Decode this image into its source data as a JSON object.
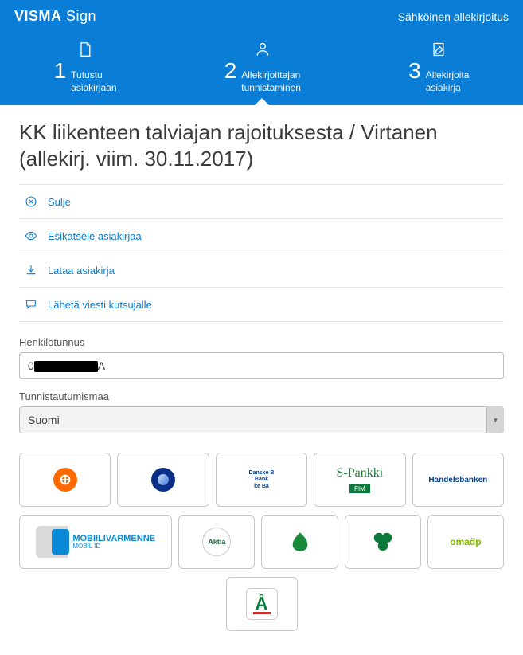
{
  "brand": {
    "name": "VISMA",
    "sub": "Sign"
  },
  "tagline": "Sähköinen allekirjoitus",
  "steps": [
    {
      "num": "1",
      "l1": "Tutustu",
      "l2": "asiakirjaan"
    },
    {
      "num": "2",
      "l1": "Allekirjoittajan",
      "l2": "tunnistaminen"
    },
    {
      "num": "3",
      "l1": "Allekirjoita",
      "l2": "asiakirja"
    }
  ],
  "title": "KK liikenteen talviajan rajoituksesta / Virtanen (allekirj. viim. 30.11.2017)",
  "actions": {
    "close": "Sulje",
    "preview": "Esikatsele asiakirjaa",
    "download": "Lataa asiakirja",
    "message": "Lähetä viesti kutsujalle"
  },
  "fields": {
    "ssn_label": "Henkilötunnus",
    "ssn_prefix": "0",
    "ssn_suffix": "A",
    "country_label": "Tunnistautumismaa",
    "country_value": "Suomi"
  },
  "providers": {
    "op": "OP",
    "nordea": "Nordea",
    "danske_l1": "Danske B",
    "danske_l2": "Bank",
    "danske_l3": "ke Ba",
    "spankki": "S-Pankki",
    "spankki_tag": "FIM",
    "handelsbanken": "Handelsbanken",
    "mobiili": "MOBIILIVARMENNE",
    "mobiili_sub": "MOBIL ID",
    "aktia": "Aktia",
    "saastopankki": "Säästöpankki",
    "pop": "POP Pankki",
    "omad": "omaḋp",
    "alandsbanken": "Å"
  }
}
